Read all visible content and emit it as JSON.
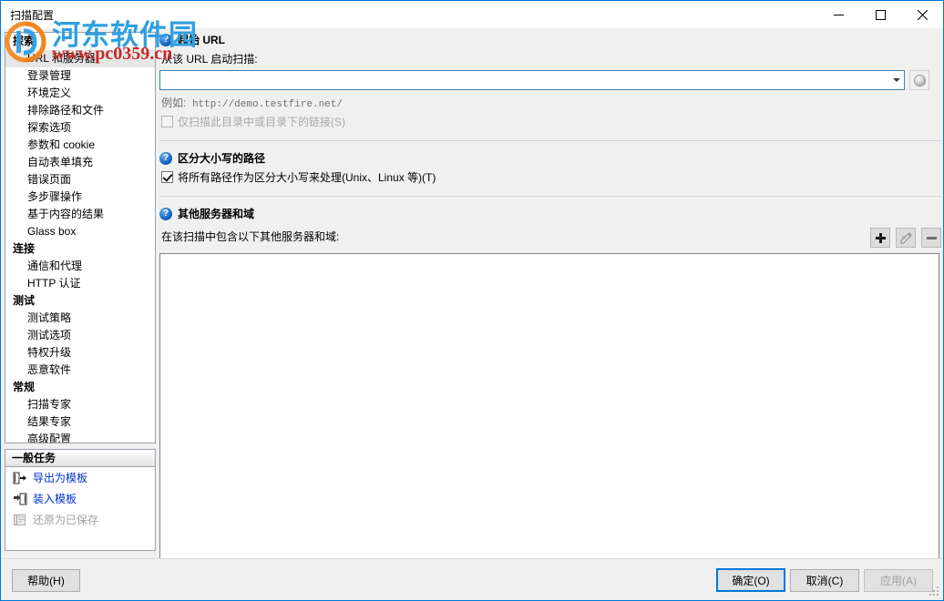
{
  "window": {
    "title": "扫描配置",
    "minimize_label": "—",
    "maximize_label": "□",
    "close_label": "✕"
  },
  "watermark": {
    "title": "河东软件园",
    "url": "www.pc0359.cn"
  },
  "sidebar": {
    "groups": [
      {
        "label": "探索",
        "items": [
          {
            "label": "URL 和服务器",
            "selected": true
          },
          {
            "label": "登录管理",
            "selected": false
          },
          {
            "label": "环境定义",
            "selected": false
          },
          {
            "label": "排除路径和文件",
            "selected": false
          },
          {
            "label": "探索选项",
            "selected": false
          },
          {
            "label": "参数和 cookie",
            "selected": false
          },
          {
            "label": "自动表单填充",
            "selected": false
          },
          {
            "label": "错误页面",
            "selected": false
          },
          {
            "label": "多步骤操作",
            "selected": false
          },
          {
            "label": "基于内容的结果",
            "selected": false
          },
          {
            "label": "Glass box",
            "selected": false
          }
        ]
      },
      {
        "label": "连接",
        "items": [
          {
            "label": "通信和代理",
            "selected": false
          },
          {
            "label": "HTTP 认证",
            "selected": false
          }
        ]
      },
      {
        "label": "测试",
        "items": [
          {
            "label": "测试策略",
            "selected": false
          },
          {
            "label": "测试选项",
            "selected": false
          },
          {
            "label": "特权升级",
            "selected": false
          },
          {
            "label": "恶意软件",
            "selected": false
          }
        ]
      },
      {
        "label": "常规",
        "items": [
          {
            "label": "扫描专家",
            "selected": false
          },
          {
            "label": "结果专家",
            "selected": false
          },
          {
            "label": "高级配置",
            "selected": false
          }
        ]
      }
    ]
  },
  "tasks_panel": {
    "header": "一般任务",
    "items": [
      {
        "label": "导出为模板",
        "icon": "export-template-icon",
        "disabled": false
      },
      {
        "label": "装入模板",
        "icon": "load-template-icon",
        "disabled": false
      },
      {
        "label": "还原为已保存",
        "icon": "restore-saved-icon",
        "disabled": true
      }
    ]
  },
  "main": {
    "start_url_section": {
      "title": "起始 URL",
      "field_label": "从该 URL 启动扫描:",
      "url_value": "",
      "url_placeholder": "",
      "example_prefix": "例如:",
      "example_url": "http://demo.testfire.net/",
      "scan_only_checkbox": {
        "label": "仅扫描此目录中或目录下的链接(S)",
        "checked": false,
        "disabled": true
      },
      "globe_button_name": "browse-globe-button",
      "dropdown_name": "url-dropdown-arrow"
    },
    "case_sensitive_section": {
      "title": "区分大小写的路径",
      "checkbox": {
        "label": "将所有路径作为区分大小写来处理(Unix、Linux 等)(T)",
        "checked": true,
        "disabled": false
      }
    },
    "other_servers_section": {
      "title": "其他服务器和域",
      "description": "在该扫描中包含以下其他服务器和域:",
      "toolbar": [
        {
          "name": "add-server-button",
          "icon": "plus-icon",
          "label": "+"
        },
        {
          "name": "edit-server-button",
          "icon": "pencil-icon",
          "label": ""
        },
        {
          "name": "remove-server-button",
          "icon": "minus-icon",
          "label": "−"
        }
      ],
      "list_items": []
    }
  },
  "footer": {
    "help": "帮助(H)",
    "ok": "确定(O)",
    "cancel": "取消(C)",
    "apply": "应用(A)"
  },
  "colors": {
    "accent": "#0078d7",
    "link": "#0033cc",
    "watermark_title": "#2f9fe0",
    "watermark_url": "#c62828"
  }
}
